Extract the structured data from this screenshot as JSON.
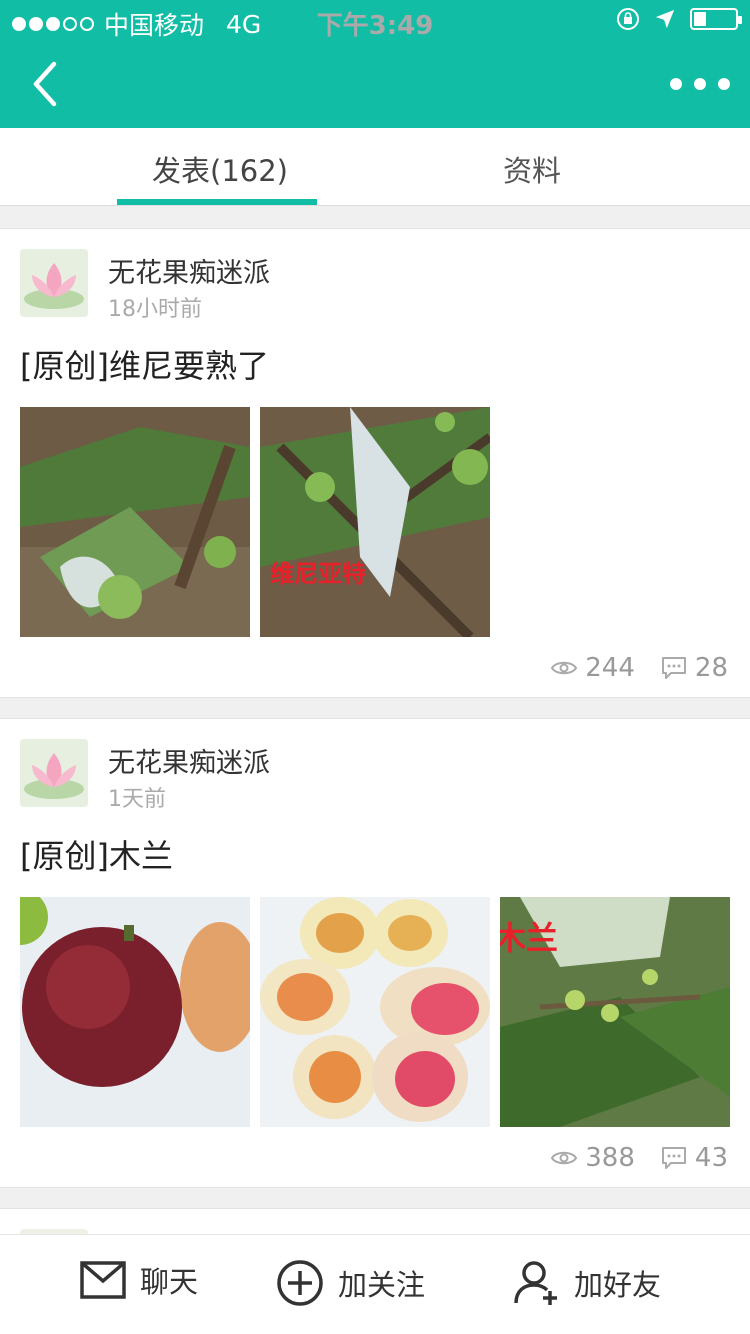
{
  "status_bar": {
    "carrier": "中国移动",
    "network": "4G",
    "time": "下午3:49",
    "signal_strength": 3,
    "signal_max": 5,
    "battery_level": 0.3,
    "icons": [
      "orientation-lock-icon",
      "location-arrow-icon",
      "battery-icon"
    ]
  },
  "header": {
    "back_icon": "chevron-left-icon",
    "more_icon": "more-horizontal-icon"
  },
  "tabs": [
    {
      "label": "发表(162)",
      "active": true
    },
    {
      "label": "资料",
      "active": false
    }
  ],
  "posts": [
    {
      "author": "无花果痴迷派",
      "time": "18小时前",
      "title": "[原创]维尼要熟了",
      "images": [
        {
          "kind": "fig-tree-photo"
        },
        {
          "kind": "fig-tree-photo",
          "overlay_text": "维尼亚特"
        }
      ],
      "views": "244",
      "comments": "28"
    },
    {
      "author": "无花果痴迷派",
      "time": "1天前",
      "title": "[原创]木兰",
      "images": [
        {
          "kind": "fig-fruit-photo"
        },
        {
          "kind": "fig-halves-photo"
        },
        {
          "kind": "fig-tree-photo",
          "overlay_text": "木兰"
        }
      ],
      "views": "388",
      "comments": "43"
    }
  ],
  "bottom_bar": {
    "chat_label": "聊天",
    "follow_label": "加关注",
    "add_friend_label": "加好友"
  },
  "colors": {
    "brand": "#12bda5",
    "text_primary": "#333333",
    "text_muted": "#999999"
  }
}
